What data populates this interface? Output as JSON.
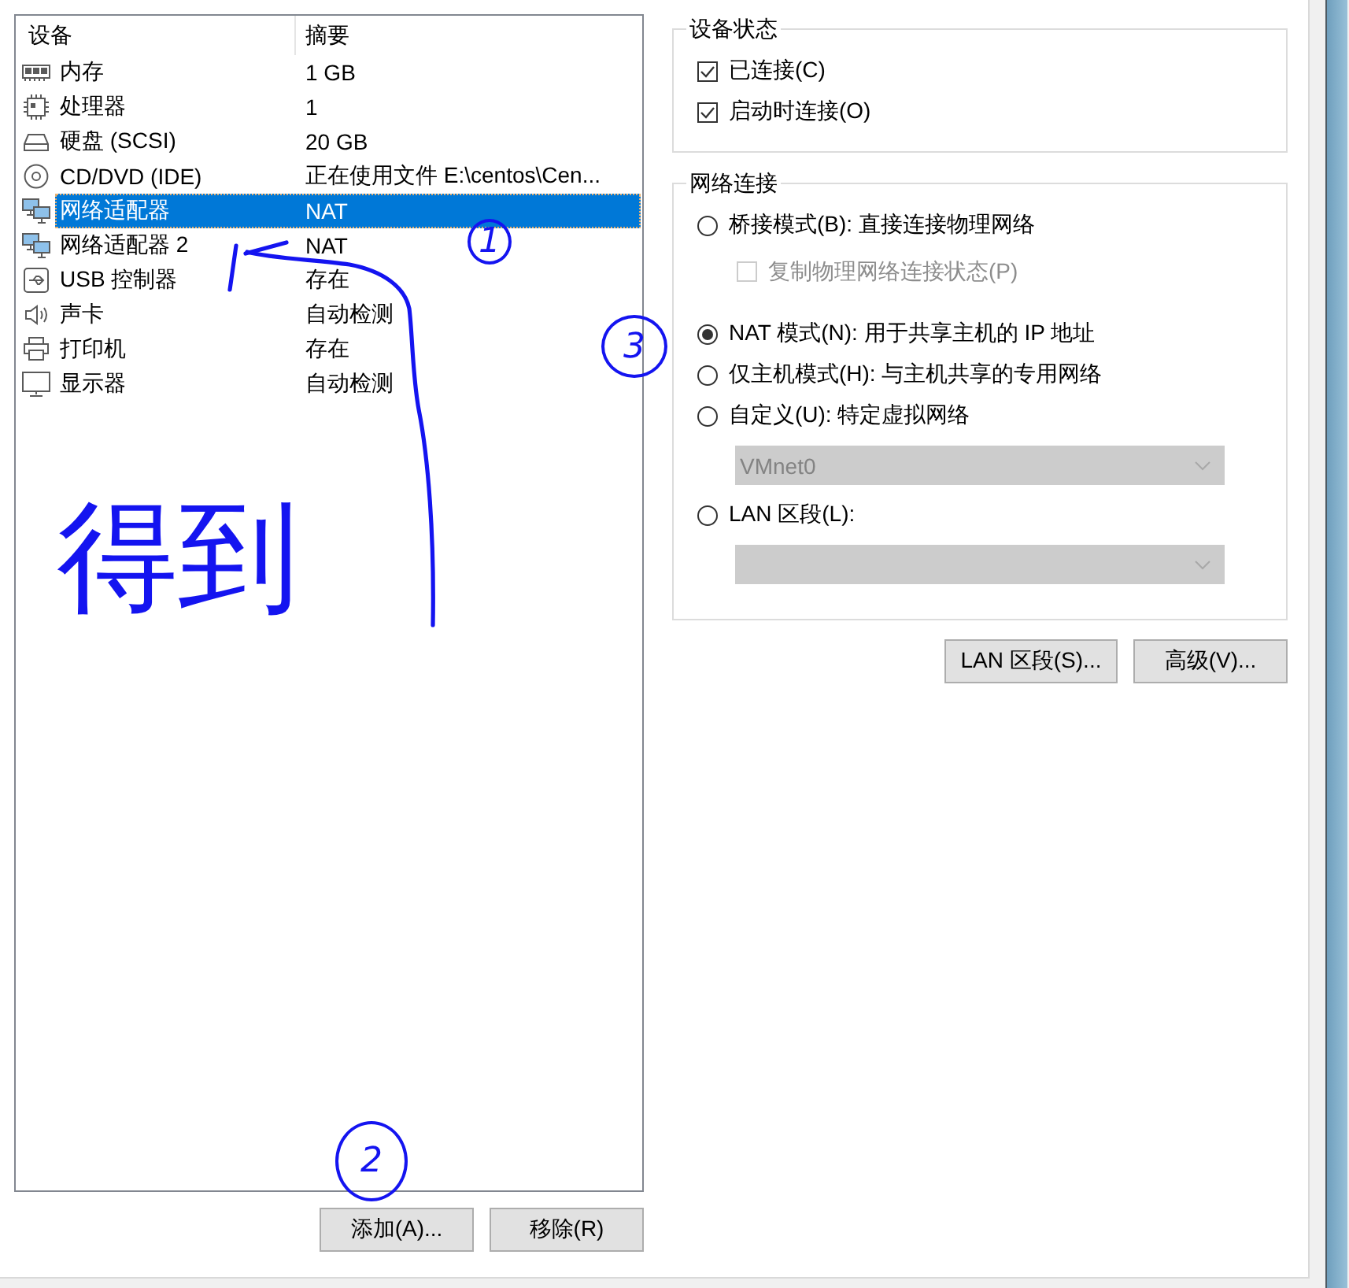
{
  "devices": {
    "columns": [
      "设备",
      "摘要"
    ],
    "rows": [
      {
        "kind": "memory",
        "name": "内存",
        "summary": "1 GB",
        "selected": false
      },
      {
        "kind": "processor",
        "name": "处理器",
        "summary": "1",
        "selected": false
      },
      {
        "kind": "disk",
        "name": "硬盘 (SCSI)",
        "summary": "20 GB",
        "selected": false
      },
      {
        "kind": "cdrom",
        "name": "CD/DVD (IDE)",
        "summary": "正在使用文件 E:\\centos\\Cen...",
        "selected": false
      },
      {
        "kind": "network",
        "name": "网络适配器",
        "summary": "NAT",
        "selected": true
      },
      {
        "kind": "network",
        "name": "网络适配器 2",
        "summary": "NAT",
        "selected": false
      },
      {
        "kind": "usb",
        "name": "USB 控制器",
        "summary": "存在",
        "selected": false
      },
      {
        "kind": "sound",
        "name": "声卡",
        "summary": "自动检测",
        "selected": false
      },
      {
        "kind": "printer",
        "name": "打印机",
        "summary": "存在",
        "selected": false
      },
      {
        "kind": "display",
        "name": "显示器",
        "summary": "自动检测",
        "selected": false
      }
    ],
    "buttons": [
      "添加(A)...",
      "移除(R)"
    ]
  },
  "device_status": {
    "title": "设备状态",
    "options": [
      {
        "label": "已连接(C)",
        "checked": true
      },
      {
        "label": "启动时连接(O)",
        "checked": true
      }
    ]
  },
  "network_connection": {
    "title": "网络连接",
    "modes": [
      {
        "label": "桥接模式(B): 直接连接物理网络",
        "selected": false,
        "option": {
          "label": "复制物理网络连接状态(P)",
          "checked": false,
          "disabled": true
        }
      },
      {
        "label": "NAT 模式(N): 用于共享主机的 IP 地址",
        "selected": true
      },
      {
        "label": "仅主机模式(H): 与主机共享的专用网络",
        "selected": false
      },
      {
        "label": "自定义(U): 特定虚拟网络",
        "selected": false,
        "dropdown": {
          "value": "VMnet0",
          "disabled": true
        }
      },
      {
        "label": "LAN 区段(L):",
        "selected": false,
        "dropdown": {
          "disabled": true
        }
      }
    ]
  },
  "network_buttons": [
    "LAN 区段(S)...",
    "高级(V)..."
  ],
  "annotations": {
    "circled_numbers": [
      {
        "text": "1"
      },
      {
        "text": "3"
      },
      {
        "text": "2"
      }
    ],
    "note": "得到"
  }
}
